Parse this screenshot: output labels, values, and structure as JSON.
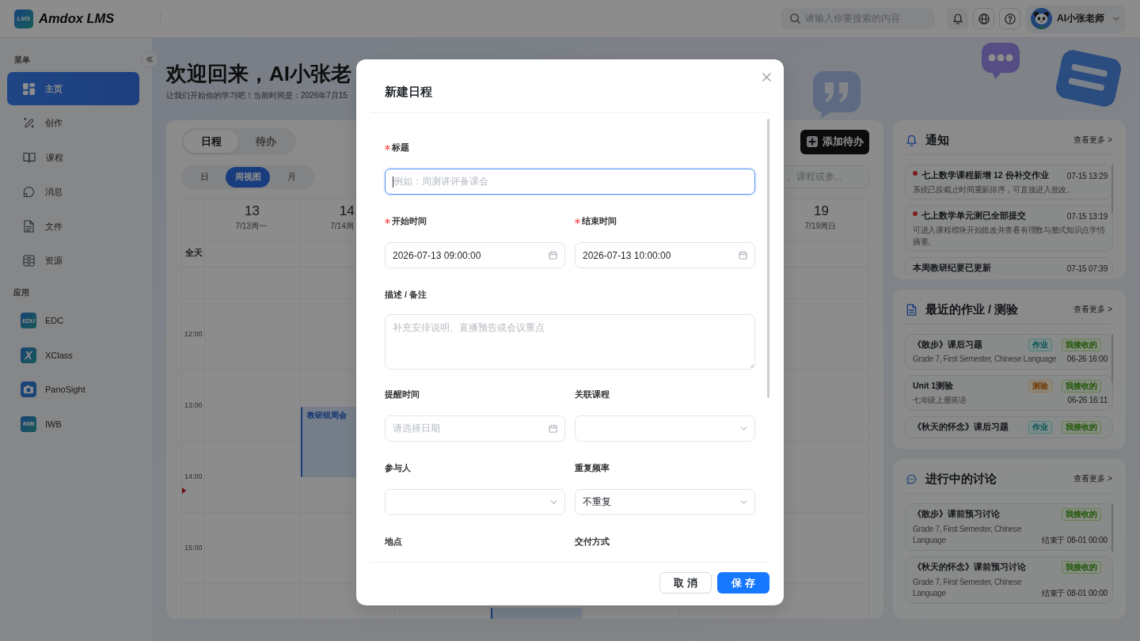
{
  "header": {
    "logo_text": "LMS",
    "app_name": "Amdox LMS",
    "search": {
      "placeholder": "请输入你要搜索的内容"
    },
    "user": {
      "name": "AI小张老师"
    }
  },
  "sidebar": {
    "sections": [
      {
        "kind": "menu",
        "title": "菜单",
        "items": [
          {
            "label": "主页",
            "selected": true
          },
          {
            "label": "创作",
            "selected": false
          },
          {
            "label": "课程",
            "selected": false
          },
          {
            "label": "消息",
            "selected": false
          },
          {
            "label": "文件",
            "selected": false
          },
          {
            "label": "资源",
            "selected": false
          }
        ]
      },
      {
        "kind": "apps",
        "title": "应用",
        "items": [
          {
            "label": "EDC",
            "icon_text": "EDU",
            "selected": false
          },
          {
            "label": "XClass",
            "icon_text": "X",
            "selected": false
          },
          {
            "label": "PanoSight",
            "selected": false
          },
          {
            "label": "IWB",
            "icon_text": "IWB",
            "selected": false
          }
        ]
      }
    ]
  },
  "welcome": {
    "title": "欢迎回来，AI小张老",
    "subtitle": "让我们开始你的学习吧！当前时间是：2026年7月15"
  },
  "calendar": {
    "tabs": [
      {
        "label": "日程",
        "selected": true
      },
      {
        "label": "待办",
        "selected": false
      }
    ],
    "add_button": "添加待办",
    "views": [
      {
        "label": "日",
        "selected": false
      },
      {
        "label": "周视图",
        "selected": true
      },
      {
        "label": "月",
        "selected": false
      }
    ],
    "search": {
      "placeholder": "、课程或参..."
    },
    "all_day_label": "全天",
    "days": [
      {
        "number": "13",
        "label": "7/13周一"
      },
      {
        "number": "14",
        "label": "7/14周"
      },
      {
        "number": "19",
        "label": "7/19周日"
      }
    ],
    "hours": [
      {
        "label": "12:00"
      },
      {
        "label": "13:00"
      },
      {
        "label": "14:00"
      },
      {
        "label": "15:00"
      }
    ],
    "events": [
      {
        "kind": "event",
        "title": "教研组周会"
      },
      {
        "kind": "event"
      }
    ]
  },
  "panels": [
    {
      "kind": "notices",
      "title": "通知",
      "more": "查看更多 >",
      "items": [
        {
          "title": "七上数学课程新增 12 份补交作业",
          "time": "07-15 13:29",
          "text": "系统已按截止时间重新排序，可直接进入批改。",
          "unread": true
        },
        {
          "title": "七上数学单元测已全部提交",
          "time": "07-15 13:19",
          "text": "可进入课程模块开始批改并查看有理数与整式知识点学情摘要。",
          "unread": true
        },
        {
          "title": "本周教研纪要已更新",
          "time": "07-15 07:39",
          "unread": false
        }
      ]
    },
    {
      "kind": "tasks",
      "title": "最近的作业 / 测验",
      "more": "查看更多 >",
      "items": [
        {
          "title": "《散步》课后习题",
          "tags": [
            {
              "text": "作业",
              "kind": "homework"
            },
            {
              "text": "我接收的",
              "kind": "status"
            }
          ],
          "text": "Grade 7, First Semester, Chinese Language",
          "time": "06-26 16:00"
        },
        {
          "title": "Unit 1测验",
          "tags": [
            {
              "text": "测验",
              "kind": "quiz"
            },
            {
              "text": "我接收的",
              "kind": "status"
            }
          ],
          "text": "七年级上册英语",
          "time": "06-26 16:11"
        },
        {
          "title": "《秋天的怀念》课后习题",
          "tags": [
            {
              "text": "作业",
              "kind": "homework"
            },
            {
              "text": "我接收的",
              "kind": "status"
            }
          ]
        }
      ]
    },
    {
      "kind": "discussions",
      "title": "进行中的讨论",
      "more": "查看更多 >",
      "items": [
        {
          "title": "《散步》课前预习讨论",
          "tags": [
            {
              "text": "我接收的",
              "kind": "status"
            }
          ],
          "text": "Grade 7, First Semester, Chinese Language",
          "time": "结束于 08-01 00:00"
        },
        {
          "title": "《秋天的怀念》课前预习讨论",
          "tags": [
            {
              "text": "我接收的",
              "kind": "status"
            }
          ],
          "text": "Grade 7, First Semester, Chinese Language",
          "time": "结束于 08-01 00:00"
        }
      ]
    }
  ],
  "dialog": {
    "title": "新建日程",
    "fields": [
      {
        "kind": "text",
        "label": "标题",
        "required": true,
        "focused": true,
        "placeholder": "例如：周测讲评备课会"
      },
      {
        "kind": "date",
        "label": "开始时间",
        "required": true,
        "focused": false,
        "value": "2026-07-13 09:00:00"
      },
      {
        "kind": "date",
        "label": "结束时间",
        "required": true,
        "focused": false,
        "value": "2026-07-13 10:00:00"
      },
      {
        "kind": "textarea",
        "label": "描述 / 备注",
        "required": false,
        "focused": false,
        "placeholder": "补充安排说明、直播预告或会议重点"
      },
      {
        "kind": "date",
        "label": "提醒时间",
        "required": false,
        "focused": false,
        "placeholder": "请选择日期"
      },
      {
        "kind": "select",
        "label": "关联课程",
        "required": false,
        "focused": false
      },
      {
        "kind": "select",
        "label": "参与人",
        "required": false,
        "focused": false
      },
      {
        "kind": "select",
        "label": "重复频率",
        "required": false,
        "focused": false,
        "value": "不重复"
      },
      {
        "label": "地点",
        "required": false
      },
      {
        "label": "交付方式",
        "required": false
      }
    ],
    "buttons": [
      {
        "label": "取 消",
        "kind": "secondary"
      },
      {
        "label": "保 存",
        "kind": "primary"
      }
    ]
  }
}
